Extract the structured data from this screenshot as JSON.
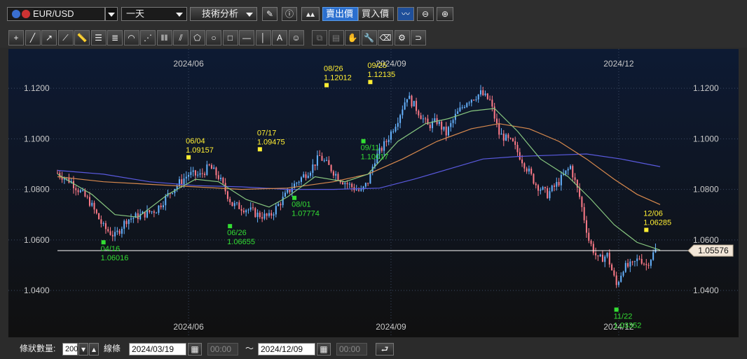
{
  "toolbar": {
    "symbol": "EUR/USD",
    "period": "一天",
    "analysis_label": "技術分析",
    "sell_label": "賣出價",
    "buy_label": "買入價"
  },
  "drawing_tools": [
    "crosshair-icon",
    "trendline-icon",
    "ray-icon",
    "extended-line-icon",
    "ruler-icon",
    "parallel-lines-icon",
    "fibonacci-icon",
    "fan-arc-icon",
    "fan-lines-icon",
    "cycle-lines-icon",
    "pitchfork-icon",
    "pentagon-icon",
    "circle-icon",
    "rectangle-icon",
    "horizontal-line-icon",
    "vertical-line-icon",
    "text-icon",
    "icon-stamp-icon",
    "copy-icon",
    "paste-icon",
    "hand-icon",
    "wrench-icon",
    "eraser-icon",
    "settings-icon",
    "magnet-icon"
  ],
  "status": {
    "count_label": "條狀數量:",
    "count_value": "200",
    "line_label": "線條",
    "start_date": "2024/03/19",
    "start_time": "00:00",
    "range_sep": "〜",
    "end_date": "2024/12/09",
    "end_time": "00:00"
  },
  "chart_data": {
    "type": "candlestick",
    "x_ticks": [
      "2024/06",
      "2024/09",
      "2024/12"
    ],
    "y_ticks": [
      "1.0400",
      "1.0600",
      "1.0800",
      "1.1000",
      "1.1200"
    ],
    "ylim": [
      1.027,
      1.13
    ],
    "current_price": "1.05576",
    "grid": true,
    "colors": {
      "up": "#66b3ff",
      "down": "#ff7b88",
      "green_ma": "#88c880",
      "orange_ma": "#d98a4e",
      "blue_ma": "#5a5adf",
      "high_label": "#ffee33",
      "low_label": "#33dd33",
      "price_line": "#ffffff"
    },
    "annotations": [
      {
        "kind": "high",
        "date": "06/04",
        "price": "1.09157"
      },
      {
        "kind": "high",
        "date": "07/17",
        "price": "1.09475"
      },
      {
        "kind": "high",
        "date": "08/26",
        "price": "1.12012"
      },
      {
        "kind": "high",
        "date": "09/25",
        "price": "1.12135"
      },
      {
        "kind": "high",
        "date": "12/06",
        "price": "1.06285"
      },
      {
        "kind": "low",
        "date": "04/16",
        "price": "1.06016"
      },
      {
        "kind": "low",
        "date": "06/26",
        "price": "1.06655"
      },
      {
        "kind": "low",
        "date": "08/01",
        "price": "1.07774"
      },
      {
        "kind": "low",
        "date": "09/11",
        "price": "1.10017"
      },
      {
        "kind": "low",
        "date": "11/22",
        "price": "1.03352"
      }
    ],
    "close_anchors": [
      [
        0,
        1.0865
      ],
      [
        6,
        1.083
      ],
      [
        14,
        1.075
      ],
      [
        20,
        1.065
      ],
      [
        25,
        1.0615
      ],
      [
        30,
        1.068
      ],
      [
        37,
        1.07
      ],
      [
        43,
        1.072
      ],
      [
        50,
        1.08
      ],
      [
        57,
        1.086
      ],
      [
        62,
        1.0855
      ],
      [
        66,
        1.089
      ],
      [
        70,
        1.085
      ],
      [
        76,
        1.074
      ],
      [
        83,
        1.072
      ],
      [
        87,
        1.07
      ],
      [
        92,
        1.069
      ],
      [
        97,
        1.075
      ],
      [
        102,
        1.081
      ],
      [
        110,
        1.088
      ],
      [
        114,
        1.093
      ],
      [
        118,
        1.089
      ],
      [
        123,
        1.084
      ],
      [
        128,
        1.081
      ],
      [
        132,
        1.079
      ],
      [
        135,
        1.083
      ],
      [
        138,
        1.092
      ],
      [
        143,
        1.099
      ],
      [
        148,
        1.108
      ],
      [
        152,
        1.117
      ],
      [
        156,
        1.112
      ],
      [
        161,
        1.105
      ],
      [
        165,
        1.107
      ],
      [
        169,
        1.102
      ],
      [
        173,
        1.109
      ],
      [
        178,
        1.115
      ],
      [
        184,
        1.118
      ],
      [
        188,
        1.115
      ],
      [
        192,
        1.102
      ],
      [
        198,
        1.098
      ],
      [
        203,
        1.09
      ],
      [
        208,
        1.082
      ],
      [
        213,
        1.078
      ],
      [
        218,
        1.083
      ],
      [
        223,
        1.089
      ],
      [
        227,
        1.077
      ],
      [
        231,
        1.06
      ],
      [
        235,
        1.052
      ],
      [
        239,
        1.054
      ],
      [
        243,
        1.042
      ],
      [
        246,
        1.049
      ],
      [
        250,
        1.05
      ],
      [
        253,
        1.053
      ],
      [
        256,
        1.05
      ],
      [
        260,
        1.056
      ]
    ],
    "ma_green": [
      [
        0,
        1.086
      ],
      [
        15,
        1.078
      ],
      [
        25,
        1.07
      ],
      [
        35,
        1.069
      ],
      [
        48,
        1.078
      ],
      [
        60,
        1.084
      ],
      [
        70,
        1.083
      ],
      [
        82,
        1.076
      ],
      [
        92,
        1.073
      ],
      [
        100,
        1.077
      ],
      [
        112,
        1.085
      ],
      [
        125,
        1.083
      ],
      [
        135,
        1.086
      ],
      [
        148,
        1.099
      ],
      [
        160,
        1.106
      ],
      [
        170,
        1.108
      ],
      [
        180,
        1.111
      ],
      [
        190,
        1.112
      ],
      [
        200,
        1.103
      ],
      [
        210,
        1.092
      ],
      [
        222,
        1.085
      ],
      [
        232,
        1.076
      ],
      [
        242,
        1.066
      ],
      [
        252,
        1.059
      ],
      [
        262,
        1.056
      ]
    ],
    "ma_orange": [
      [
        0,
        1.085
      ],
      [
        20,
        1.083
      ],
      [
        40,
        1.082
      ],
      [
        60,
        1.081
      ],
      [
        80,
        1.08
      ],
      [
        100,
        1.0805
      ],
      [
        120,
        1.083
      ],
      [
        135,
        1.086
      ],
      [
        150,
        1.092
      ],
      [
        165,
        1.099
      ],
      [
        180,
        1.104
      ],
      [
        192,
        1.106
      ],
      [
        205,
        1.104
      ],
      [
        218,
        1.099
      ],
      [
        230,
        1.092
      ],
      [
        242,
        1.084
      ],
      [
        252,
        1.078
      ],
      [
        262,
        1.074
      ]
    ],
    "ma_blue": [
      [
        0,
        1.0875
      ],
      [
        20,
        1.086
      ],
      [
        40,
        1.083
      ],
      [
        60,
        1.0815
      ],
      [
        80,
        1.081
      ],
      [
        100,
        1.08
      ],
      [
        120,
        1.08
      ],
      [
        140,
        1.0805
      ],
      [
        155,
        1.084
      ],
      [
        170,
        1.088
      ],
      [
        185,
        1.092
      ],
      [
        200,
        1.093
      ],
      [
        215,
        1.0935
      ],
      [
        230,
        1.094
      ],
      [
        245,
        1.092
      ],
      [
        262,
        1.089
      ]
    ]
  }
}
